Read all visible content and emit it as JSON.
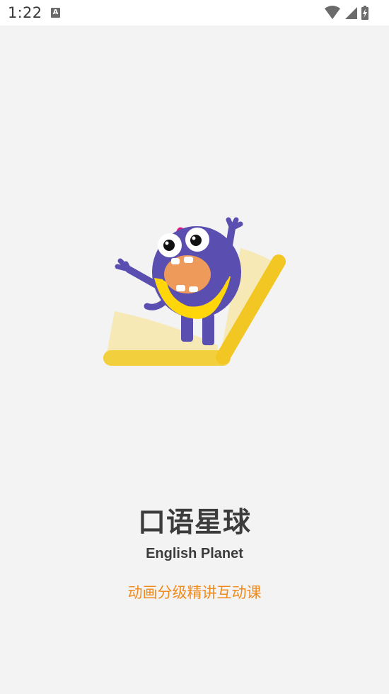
{
  "status_bar": {
    "time": "1:22",
    "notification_icon_letter": "A",
    "icons": [
      "wifi-icon",
      "cellular-signal-icon",
      "battery-charging-icon"
    ]
  },
  "splash": {
    "title": "口语星球",
    "subtitle": "English Planet",
    "tagline": "动画分级精讲互动课",
    "mascot": "purple-monster-on-book-illustration"
  },
  "colors": {
    "background": "#f3f3f3",
    "title": "#3c3c3c",
    "tagline": "#f08a1d",
    "mascot_body": "#5a4fb0",
    "book_page": "#f7e9b5",
    "book_spine": "#f2c623",
    "bib": "#ffd60a",
    "mouth": "#ee9a5b",
    "horn": "#e2127c"
  }
}
